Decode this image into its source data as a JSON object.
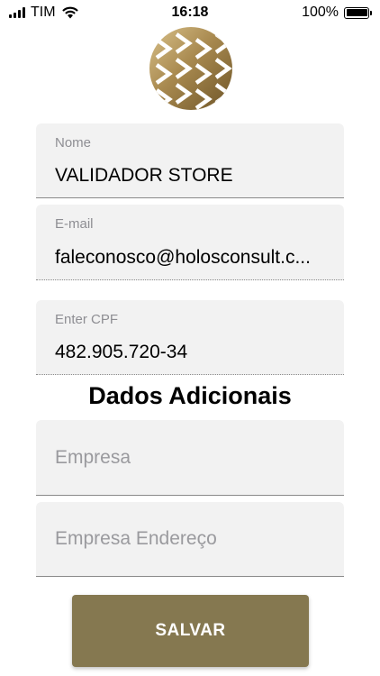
{
  "status_bar": {
    "carrier": "TIM",
    "time": "16:18",
    "battery": "100%"
  },
  "logo": {
    "icon": "gold-chevron-pattern-logo"
  },
  "form": {
    "name": {
      "label": "Nome",
      "value": "VALIDADOR STORE"
    },
    "email": {
      "label": "E-mail",
      "value": "faleconosco@holosconsult.c..."
    },
    "cpf": {
      "label": "Enter CPF",
      "value": "482.905.720-34"
    }
  },
  "additional": {
    "title": "Dados Adicionais",
    "company_placeholder": "Empresa",
    "company_address_placeholder": "Empresa Endereço"
  },
  "actions": {
    "save_label": "SALVAR"
  },
  "colors": {
    "accent": "#857850",
    "field_bg": "#f2f2f2"
  }
}
